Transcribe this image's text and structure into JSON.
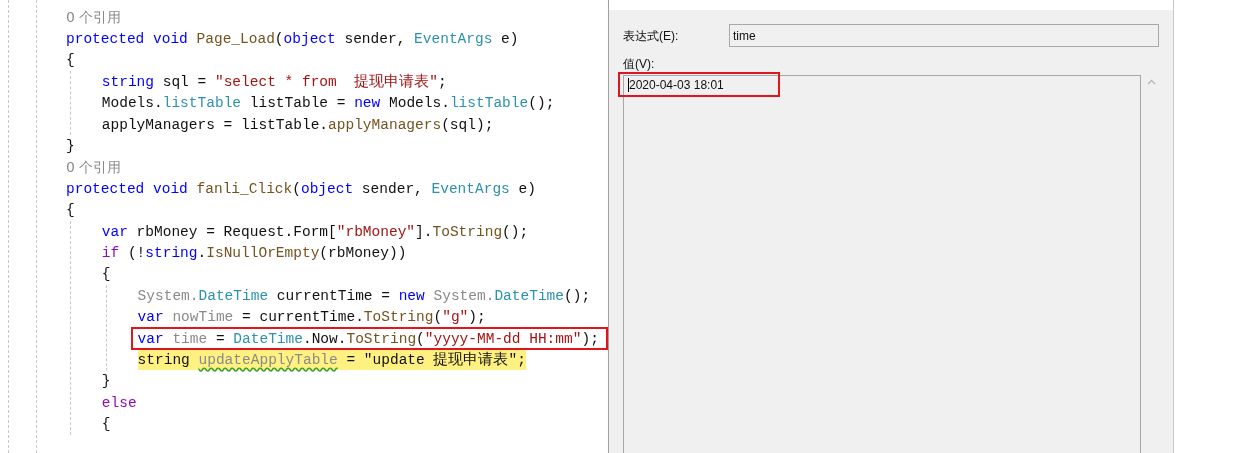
{
  "editor": {
    "lines": [
      {
        "kind": "reference",
        "text": "0 个引用"
      },
      {
        "kind": "code",
        "boxed": false,
        "highlighted": false,
        "tokens": [
          {
            "text": "protected void",
            "kind": "keyword"
          },
          {
            "text": " Page_Load",
            "kind": "method"
          },
          {
            "text": "(",
            "kind": "plain"
          },
          {
            "text": "object",
            "kind": "keyword"
          },
          {
            "text": " sender, ",
            "kind": "plain"
          },
          {
            "text": "EventArgs",
            "kind": "type"
          },
          {
            "text": " e)",
            "kind": "plain"
          }
        ]
      },
      {
        "kind": "code",
        "boxed": false,
        "highlighted": false,
        "tokens": [
          {
            "text": "{",
            "kind": "plain"
          }
        ],
        "children": [
          {
            "kind": "code",
            "boxed": false,
            "highlighted": false,
            "tokens": [
              {
                "text": "string",
                "kind": "keyword"
              },
              {
                "text": " sql = ",
                "kind": "plain"
              },
              {
                "text": "\"select * from  提现申请表\"",
                "kind": "string"
              },
              {
                "text": ";",
                "kind": "plain"
              }
            ]
          },
          {
            "kind": "code",
            "boxed": false,
            "highlighted": false,
            "tokens": [
              {
                "text": "Models.",
                "kind": "plain"
              },
              {
                "text": "listTable",
                "kind": "type"
              },
              {
                "text": " listTable = ",
                "kind": "plain"
              },
              {
                "text": "new",
                "kind": "keyword"
              },
              {
                "text": " Models.",
                "kind": "plain"
              },
              {
                "text": "listTable",
                "kind": "type"
              },
              {
                "text": "();",
                "kind": "plain"
              }
            ]
          },
          {
            "kind": "code",
            "boxed": false,
            "highlighted": false,
            "tokens": [
              {
                "text": "applyManagers = listTable.",
                "kind": "plain"
              },
              {
                "text": "applyManagers",
                "kind": "method"
              },
              {
                "text": "(sql);",
                "kind": "plain"
              }
            ]
          }
        ]
      },
      {
        "kind": "code",
        "boxed": false,
        "highlighted": false,
        "tokens": [
          {
            "text": "}",
            "kind": "plain"
          }
        ]
      },
      {
        "kind": "reference",
        "text": "0 个引用"
      },
      {
        "kind": "code",
        "boxed": false,
        "highlighted": false,
        "tokens": [
          {
            "text": "protected void",
            "kind": "keyword"
          },
          {
            "text": " fanli_Click",
            "kind": "method"
          },
          {
            "text": "(",
            "kind": "plain"
          },
          {
            "text": "object",
            "kind": "keyword"
          },
          {
            "text": " sender, ",
            "kind": "plain"
          },
          {
            "text": "EventArgs",
            "kind": "type"
          },
          {
            "text": " e)",
            "kind": "plain"
          }
        ]
      },
      {
        "kind": "code",
        "boxed": false,
        "highlighted": false,
        "tokens": [
          {
            "text": "{",
            "kind": "plain"
          }
        ],
        "children": [
          {
            "kind": "code",
            "boxed": false,
            "highlighted": false,
            "tokens": [
              {
                "text": "var",
                "kind": "keyword"
              },
              {
                "text": " rbMoney = Request.Form[",
                "kind": "plain"
              },
              {
                "text": "\"rbMoney\"",
                "kind": "string"
              },
              {
                "text": "].",
                "kind": "plain"
              },
              {
                "text": "ToString",
                "kind": "method"
              },
              {
                "text": "();",
                "kind": "plain"
              }
            ]
          },
          {
            "kind": "code",
            "boxed": false,
            "highlighted": false,
            "tokens": [
              {
                "text": "if",
                "kind": "control"
              },
              {
                "text": " (!",
                "kind": "plain"
              },
              {
                "text": "string",
                "kind": "keyword"
              },
              {
                "text": ".",
                "kind": "plain"
              },
              {
                "text": "IsNullOrEmpty",
                "kind": "method"
              },
              {
                "text": "(rbMoney))",
                "kind": "plain"
              }
            ]
          },
          {
            "kind": "code",
            "boxed": false,
            "highlighted": false,
            "tokens": [
              {
                "text": "{",
                "kind": "plain"
              }
            ],
            "children": [
              {
                "kind": "code",
                "boxed": false,
                "highlighted": false,
                "tokens": [
                  {
                    "text": "System.",
                    "kind": "faded"
                  },
                  {
                    "text": "DateTime",
                    "kind": "type"
                  },
                  {
                    "text": " currentTime = ",
                    "kind": "plain"
                  },
                  {
                    "text": "new",
                    "kind": "keyword"
                  },
                  {
                    "text": " System.",
                    "kind": "faded"
                  },
                  {
                    "text": "DateTime",
                    "kind": "type"
                  },
                  {
                    "text": "();",
                    "kind": "plain"
                  }
                ]
              },
              {
                "kind": "code",
                "boxed": false,
                "highlighted": false,
                "tokens": [
                  {
                    "text": "var",
                    "kind": "keyword"
                  },
                  {
                    "text": " nowTime",
                    "kind": "faded"
                  },
                  {
                    "text": " = currentTime.",
                    "kind": "plain"
                  },
                  {
                    "text": "ToString",
                    "kind": "method"
                  },
                  {
                    "text": "(",
                    "kind": "plain"
                  },
                  {
                    "text": "\"g\"",
                    "kind": "string"
                  },
                  {
                    "text": ");",
                    "kind": "plain"
                  }
                ]
              },
              {
                "kind": "code",
                "boxed": true,
                "highlighted": false,
                "tokens": [
                  {
                    "text": "var",
                    "kind": "keyword"
                  },
                  {
                    "text": " time",
                    "kind": "faded"
                  },
                  {
                    "text": " = ",
                    "kind": "plain"
                  },
                  {
                    "text": "DateTime",
                    "kind": "type"
                  },
                  {
                    "text": ".Now.",
                    "kind": "plain"
                  },
                  {
                    "text": "ToString",
                    "kind": "method"
                  },
                  {
                    "text": "(",
                    "kind": "plain"
                  },
                  {
                    "text": "\"yyyy-MM-dd HH:mm\"",
                    "kind": "string"
                  },
                  {
                    "text": ");",
                    "kind": "plain"
                  }
                ]
              },
              {
                "kind": "code",
                "boxed": false,
                "highlighted": true,
                "tokens": [
                  {
                    "text": "string ",
                    "kind": "plain"
                  },
                  {
                    "text": "updateApplyTable",
                    "kind": "warning"
                  },
                  {
                    "text": " = \"update 提现申请表\";",
                    "kind": "plain"
                  }
                ]
              }
            ]
          },
          {
            "kind": "code",
            "boxed": false,
            "highlighted": false,
            "tokens": [
              {
                "text": "}",
                "kind": "plain"
              }
            ]
          },
          {
            "kind": "code",
            "boxed": false,
            "highlighted": false,
            "tokens": [
              {
                "text": "else",
                "kind": "control"
              }
            ]
          },
          {
            "kind": "code",
            "boxed": false,
            "highlighted": false,
            "tokens": [
              {
                "text": "{",
                "kind": "plain"
              }
            ]
          }
        ]
      }
    ]
  },
  "dialog": {
    "expression_label": "表达式(E):",
    "expression": "time",
    "value_label": "值(V):",
    "value": "2020-04-03 18:01",
    "value_boxed": true
  }
}
